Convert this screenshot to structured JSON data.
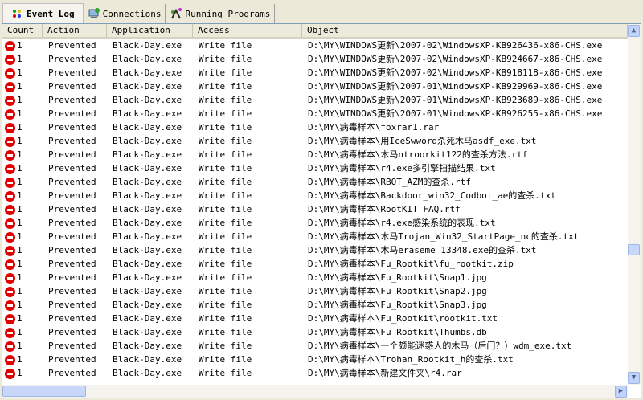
{
  "tabs": [
    {
      "label": "Event Log",
      "icon": "event-log-icon"
    },
    {
      "label": "Connections",
      "icon": "connections-icon"
    },
    {
      "label": "Running Programs",
      "icon": "running-programs-icon"
    }
  ],
  "columns": [
    "Count",
    "Action",
    "Application",
    "Access",
    "Object"
  ],
  "rows": [
    [
      "1",
      "Prevented",
      "Black-Day.exe",
      "Write file",
      "D:\\MY\\WINDOWS更新\\2007-02\\WindowsXP-KB926436-x86-CHS.exe"
    ],
    [
      "1",
      "Prevented",
      "Black-Day.exe",
      "Write file",
      "D:\\MY\\WINDOWS更新\\2007-02\\WindowsXP-KB924667-x86-CHS.exe"
    ],
    [
      "1",
      "Prevented",
      "Black-Day.exe",
      "Write file",
      "D:\\MY\\WINDOWS更新\\2007-02\\WindowsXP-KB918118-x86-CHS.exe"
    ],
    [
      "1",
      "Prevented",
      "Black-Day.exe",
      "Write file",
      "D:\\MY\\WINDOWS更新\\2007-01\\WindowsXP-KB929969-x86-CHS.exe"
    ],
    [
      "1",
      "Prevented",
      "Black-Day.exe",
      "Write file",
      "D:\\MY\\WINDOWS更新\\2007-01\\WindowsXP-KB923689-x86-CHS.exe"
    ],
    [
      "1",
      "Prevented",
      "Black-Day.exe",
      "Write file",
      "D:\\MY\\WINDOWS更新\\2007-01\\WindowsXP-KB926255-x86-CHS.exe"
    ],
    [
      "1",
      "Prevented",
      "Black-Day.exe",
      "Write file",
      "D:\\MY\\病毒样本\\foxrar1.rar"
    ],
    [
      "1",
      "Prevented",
      "Black-Day.exe",
      "Write file",
      "D:\\MY\\病毒样本\\用IceSwword杀死木马asdf_exe.txt"
    ],
    [
      "1",
      "Prevented",
      "Black-Day.exe",
      "Write file",
      "D:\\MY\\病毒样本\\木马ntroorkit122的查杀方法.rtf"
    ],
    [
      "1",
      "Prevented",
      "Black-Day.exe",
      "Write file",
      "D:\\MY\\病毒样本\\r4.exe多引擎扫描结果.txt"
    ],
    [
      "1",
      "Prevented",
      "Black-Day.exe",
      "Write file",
      "D:\\MY\\病毒样本\\RBOT_AZM的查杀.rtf"
    ],
    [
      "1",
      "Prevented",
      "Black-Day.exe",
      "Write file",
      "D:\\MY\\病毒样本\\Backdoor_win32_Codbot_ae的查杀.txt"
    ],
    [
      "1",
      "Prevented",
      "Black-Day.exe",
      "Write file",
      "D:\\MY\\病毒样本\\RootKIT FAQ.rtf"
    ],
    [
      "1",
      "Prevented",
      "Black-Day.exe",
      "Write file",
      "D:\\MY\\病毒样本\\r4.exe感染系统的表现.txt"
    ],
    [
      "1",
      "Prevented",
      "Black-Day.exe",
      "Write file",
      "D:\\MY\\病毒样本\\木马Trojan_Win32_StartPage_nc的查杀.txt"
    ],
    [
      "1",
      "Prevented",
      "Black-Day.exe",
      "Write file",
      "D:\\MY\\病毒样本\\木马eraseme_13348.exe的查杀.txt"
    ],
    [
      "1",
      "Prevented",
      "Black-Day.exe",
      "Write file",
      "D:\\MY\\病毒样本\\Fu_Rootkit\\fu_rootkit.zip"
    ],
    [
      "1",
      "Prevented",
      "Black-Day.exe",
      "Write file",
      "D:\\MY\\病毒样本\\Fu_Rootkit\\Snap1.jpg"
    ],
    [
      "1",
      "Prevented",
      "Black-Day.exe",
      "Write file",
      "D:\\MY\\病毒样本\\Fu_Rootkit\\Snap2.jpg"
    ],
    [
      "1",
      "Prevented",
      "Black-Day.exe",
      "Write file",
      "D:\\MY\\病毒样本\\Fu_Rootkit\\Snap3.jpg"
    ],
    [
      "1",
      "Prevented",
      "Black-Day.exe",
      "Write file",
      "D:\\MY\\病毒样本\\Fu_Rootkit\\rootkit.txt"
    ],
    [
      "1",
      "Prevented",
      "Black-Day.exe",
      "Write file",
      "D:\\MY\\病毒样本\\Fu_Rootkit\\Thumbs.db"
    ],
    [
      "1",
      "Prevented",
      "Black-Day.exe",
      "Write file",
      "D:\\MY\\病毒样本\\一个颇能迷惑人的木马（后门？）wdm_exe.txt"
    ],
    [
      "1",
      "Prevented",
      "Black-Day.exe",
      "Write file",
      "D:\\MY\\病毒样本\\Trohan_Rootkit_h的查杀.txt"
    ],
    [
      "1",
      "Prevented",
      "Black-Day.exe",
      "Write file",
      "D:\\MY\\病毒样本\\新建文件夹\\r4.rar"
    ]
  ],
  "colors": {
    "prevented": "#e00000",
    "border": "#7f9db9"
  }
}
